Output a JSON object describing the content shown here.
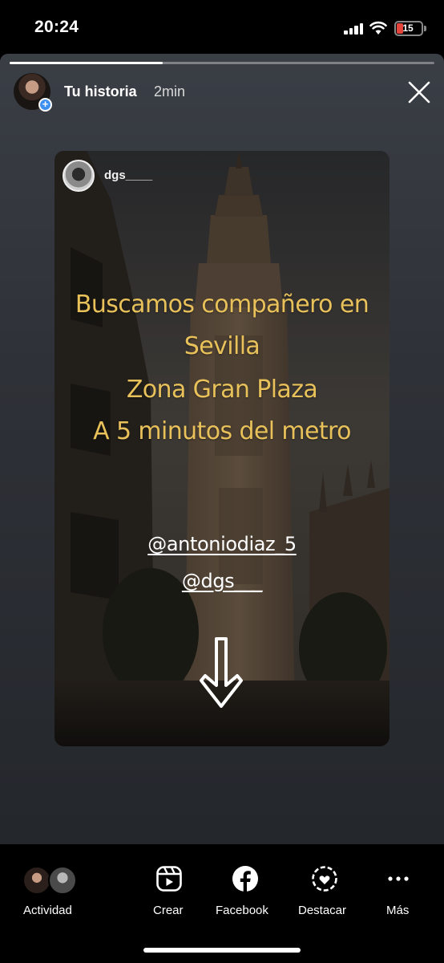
{
  "status_bar": {
    "time": "20:24",
    "battery": "15"
  },
  "story": {
    "progress": 0.36,
    "header": {
      "title": "Tu historia",
      "time": "2min"
    },
    "card": {
      "username": "dgs____",
      "lines": [
        "Buscamos compañero en",
        "Sevilla",
        "Zona Gran Plaza",
        "A 5 minutos del metro"
      ],
      "mentions": [
        "@antoniodiaz_5",
        "@dgs___"
      ],
      "text_color": "#e8c15a"
    }
  },
  "bottom_bar": {
    "actividad": "Actividad",
    "crear": "Crear",
    "facebook": "Facebook",
    "destacar": "Destacar",
    "mas": "Más"
  }
}
